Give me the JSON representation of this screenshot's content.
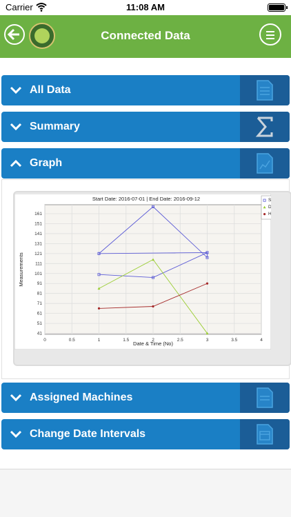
{
  "status_bar": {
    "carrier": "Carrier",
    "time": "11:08 AM"
  },
  "nav": {
    "title": "Connected Data"
  },
  "sections": [
    {
      "label": "All Data",
      "icon": "document-icon",
      "expanded": false
    },
    {
      "label": "Summary",
      "icon": "sigma-icon",
      "expanded": false
    },
    {
      "label": "Graph",
      "icon": "chart-doc-icon",
      "expanded": true
    },
    {
      "label": "Assigned Machines",
      "icon": "document-icon",
      "expanded": false
    },
    {
      "label": "Change Date Intervals",
      "icon": "calendar-doc-icon",
      "expanded": false
    }
  ],
  "colors": {
    "nav_green": "#6db143",
    "section_blue": "#1a7fc5",
    "sys": "#5b5bd6",
    "dia": "#9acd32",
    "hr": "#a52a2a"
  },
  "chart_data": {
    "type": "line",
    "title": "Start Date: 2016-07-01 | End Date: 2016-09-12",
    "xlabel": "Date & Time (No)",
    "ylabel": "Measurements",
    "xlim": [
      0,
      4
    ],
    "ylim": [
      40,
      170
    ],
    "x_ticks": [
      "0",
      "0.5",
      "1",
      "1.5",
      "2",
      "2.5",
      "3",
      "3.5",
      "4"
    ],
    "y_ticks": [
      "41",
      "51",
      "61",
      "71",
      "81",
      "91",
      "101",
      "111",
      "121",
      "131",
      "141",
      "151",
      "161"
    ],
    "legend_position": "top-right",
    "grid": true,
    "series": [
      {
        "name": "SYS",
        "color": "#5b5bd6",
        "marker": "square",
        "points": [
          [
            1,
            121
          ],
          [
            2,
            168
          ],
          [
            3,
            117
          ],
          [
            3,
            122
          ],
          [
            1,
            121
          ]
        ]
      },
      {
        "name": "SYS",
        "color": "#5b5bd6",
        "marker": "square",
        "points": [
          [
            1,
            100
          ],
          [
            2,
            97
          ],
          [
            3,
            122
          ]
        ]
      },
      {
        "name": "DIA",
        "color": "#9acd32",
        "marker": "triangle",
        "points": [
          [
            1,
            86
          ],
          [
            2,
            115
          ],
          [
            3,
            41
          ]
        ]
      },
      {
        "name": "HR",
        "color": "#a52a2a",
        "marker": "diamond",
        "points": [
          [
            1,
            66
          ],
          [
            2,
            68
          ],
          [
            3,
            91
          ]
        ]
      }
    ],
    "legend": [
      "SYS",
      "DIA",
      "HR"
    ]
  }
}
